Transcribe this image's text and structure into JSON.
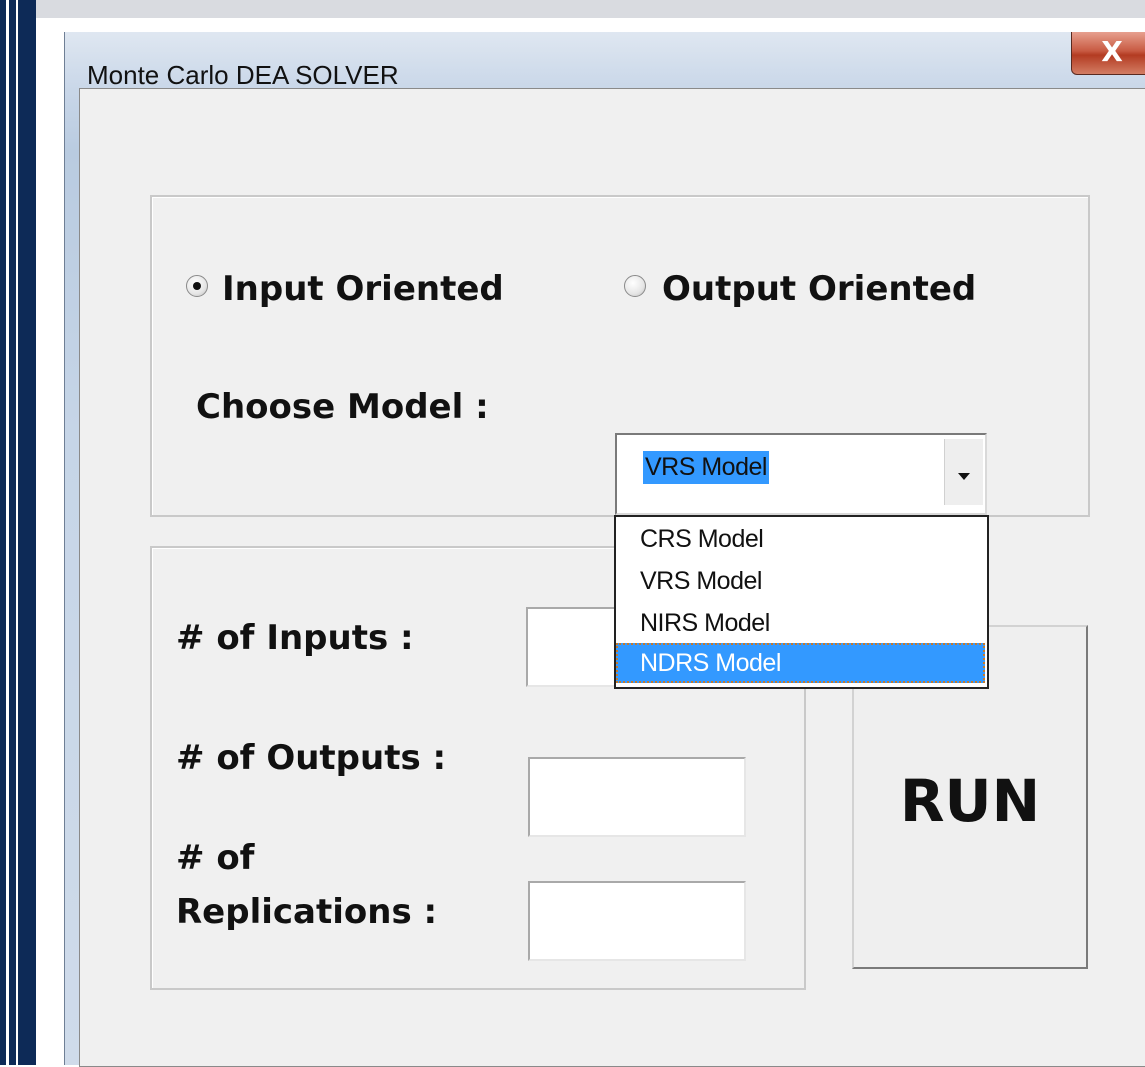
{
  "window": {
    "title": "Monte Carlo DEA SOLVER",
    "close_label": "X"
  },
  "orientation": {
    "input_label": "Input Oriented",
    "output_label": "Output Oriented",
    "selected": "Input Oriented"
  },
  "model": {
    "label": "Choose Model :",
    "value": "VRS Model",
    "options": [
      "CRS Model",
      "VRS Model",
      "NIRS Model",
      "NDRS Model"
    ],
    "highlighted_option": "NDRS Model"
  },
  "fields": {
    "inputs_label": "# of Inputs :",
    "outputs_label": "# of Outputs :",
    "replications_label_line1": "# of",
    "replications_label_line2": "Replications :",
    "inputs_value": "",
    "outputs_value": "",
    "replications_value": ""
  },
  "run_label": "RUN",
  "colors": {
    "selection": "#3399ff",
    "frame_edge": "#0d2a57",
    "close_button": "#c85a42"
  }
}
